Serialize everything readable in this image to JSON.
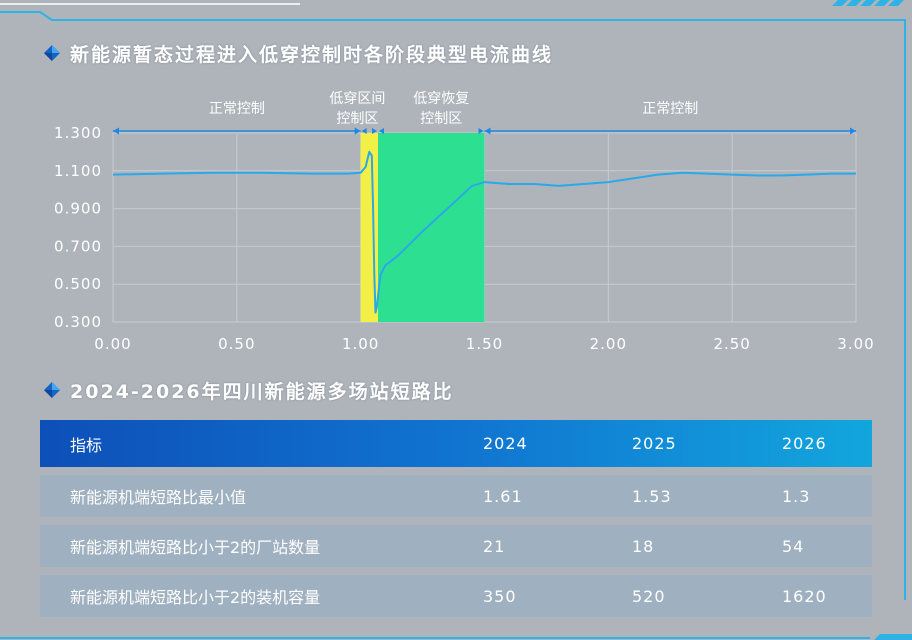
{
  "colors": {
    "panel_bg": "#afb4ba",
    "accent": "#1e88e5",
    "frame": "#2fb3e6",
    "lvrt_zone": "#f2f046",
    "recovery_zone": "#2de091",
    "curve": "#2ba8e8",
    "table_header": "#0d4fb8",
    "table_row": "#9fb0c0"
  },
  "section1": {
    "title": "新能源暂态过程进入低穿控制时各阶段典型电流曲线",
    "icon": "diamond-icon"
  },
  "section2": {
    "title": "2024-2026年四川新能源多场站短路比",
    "icon": "diamond-icon"
  },
  "chart_data": {
    "type": "line",
    "title": "新能源暂态过程进入低穿控制时各阶段典型电流曲线",
    "xlim": [
      0,
      3
    ],
    "ylim": [
      0.3,
      1.3
    ],
    "x_ticks": [
      "0.00",
      "0.50",
      "1.00",
      "1.50",
      "2.00",
      "2.50",
      "3.00"
    ],
    "y_ticks": [
      "1.300",
      "1.100",
      "0.900",
      "0.700",
      "0.500",
      "0.300"
    ],
    "grid": true,
    "regions": [
      {
        "label_lines": [
          "正常控制"
        ],
        "x0": 0.0,
        "x1": 1.0,
        "type": "normal"
      },
      {
        "label_lines": [
          "低穿区间",
          "控制区"
        ],
        "x0": 1.0,
        "x1": 1.07,
        "type": "lvrt"
      },
      {
        "label_lines": [
          "低穿恢复",
          "控制区"
        ],
        "x0": 1.07,
        "x1": 1.5,
        "type": "recovery"
      },
      {
        "label_lines": [
          "正常控制"
        ],
        "x0": 1.5,
        "x1": 3.0,
        "type": "normal"
      }
    ],
    "series": [
      {
        "x": [
          0.0,
          0.2,
          0.4,
          0.6,
          0.8,
          0.95,
          1.0,
          1.02,
          1.035,
          1.045,
          1.05,
          1.055,
          1.06,
          1.065,
          1.08,
          1.1,
          1.15,
          1.25,
          1.35,
          1.45,
          1.5,
          1.6,
          1.7,
          1.8,
          1.9,
          2.0,
          2.1,
          2.2,
          2.3,
          2.4,
          2.5,
          2.6,
          2.7,
          2.8,
          2.9,
          3.0
        ],
        "y": [
          1.08,
          1.085,
          1.09,
          1.09,
          1.085,
          1.085,
          1.09,
          1.12,
          1.2,
          1.18,
          0.9,
          0.55,
          0.35,
          0.38,
          0.55,
          0.6,
          0.65,
          0.78,
          0.9,
          1.02,
          1.04,
          1.03,
          1.03,
          1.02,
          1.03,
          1.04,
          1.06,
          1.08,
          1.09,
          1.085,
          1.08,
          1.075,
          1.075,
          1.08,
          1.085,
          1.085
        ]
      }
    ]
  },
  "table": {
    "headers": [
      "指标",
      "2024",
      "2025",
      "2026"
    ],
    "rows": [
      [
        "新能源机端短路比最小值",
        "1.61",
        "1.53",
        "1.3"
      ],
      [
        "新能源机端短路比小于2的厂站数量",
        "21",
        "18",
        "54"
      ],
      [
        "新能源机端短路比小于2的装机容量",
        "350",
        "520",
        "1620"
      ]
    ]
  }
}
